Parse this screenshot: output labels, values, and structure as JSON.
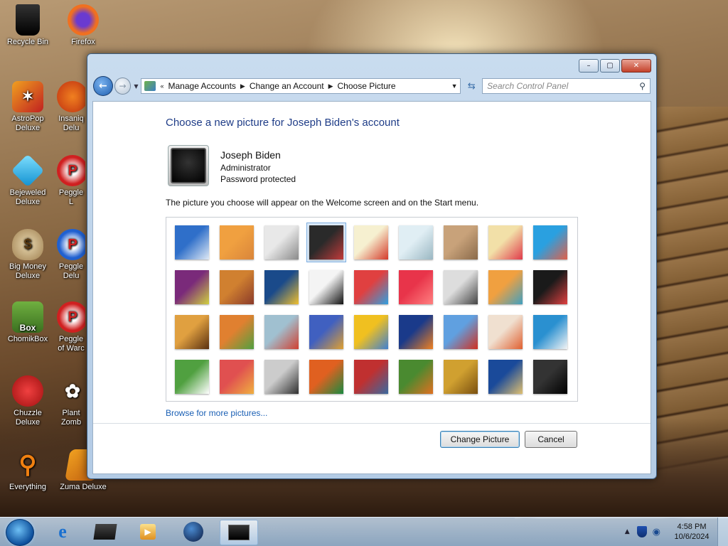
{
  "desktop": {
    "icons": [
      {
        "label": "Recycle Bin",
        "icon": "recycle-bin-icon"
      },
      {
        "label": "Firefox",
        "icon": "firefox-icon"
      },
      {
        "label": "AstroPop Deluxe",
        "icon": "astropop-icon"
      },
      {
        "label": "Insaniq Delu",
        "icon": "insaniquarium-icon"
      },
      {
        "label": "Bejeweled Deluxe",
        "icon": "bejeweled-icon"
      },
      {
        "label": "Peggle L",
        "icon": "peggle-icon"
      },
      {
        "label": "Big Money Deluxe",
        "icon": "money-bag-icon"
      },
      {
        "label": "Peggle Delu",
        "icon": "peggle-icon"
      },
      {
        "label": "ChomikBox",
        "icon": "chomikbox-icon"
      },
      {
        "label": "Peggle of Warc",
        "icon": "peggle-icon"
      },
      {
        "label": "Chuzzle Deluxe",
        "icon": "chuzzle-icon"
      },
      {
        "label": "Plant Zomb",
        "icon": "plants-zombies-icon"
      },
      {
        "label": "Everything",
        "icon": "magnifier-icon"
      },
      {
        "label": "Zuma Deluxe",
        "icon": "zuma-icon"
      }
    ]
  },
  "window": {
    "controls": {
      "minimize": "–",
      "maximize": "▢",
      "close": "✕"
    },
    "nav": {
      "back": "←",
      "forward": "→",
      "breadcrumbs": [
        "Manage Accounts",
        "Change an Account",
        "Choose Picture"
      ],
      "search_placeholder": "Search Control Panel"
    },
    "title": "Choose a new picture for Joseph Biden's account",
    "user": {
      "name": "Joseph Biden",
      "role": "Administrator",
      "status": "Password protected"
    },
    "description": "The picture you choose will appear on the Welcome screen and on the Start menu.",
    "pictures": [
      {
        "name": "roller-coaster",
        "c1": "#2f6fc9",
        "c2": "#dfe9f5"
      },
      {
        "name": "starfish",
        "c1": "#f0a040",
        "c2": "#d9853a"
      },
      {
        "name": "robot-toy",
        "c1": "#e8e8e8",
        "c2": "#8a8a8a"
      },
      {
        "name": "record-player",
        "c1": "#2a2a2a",
        "c2": "#c23a3a"
      },
      {
        "name": "lucky-cat",
        "c1": "#f6f0d0",
        "c2": "#d43a2a"
      },
      {
        "name": "gyroscope",
        "c1": "#e0eef4",
        "c2": "#9ab7c2"
      },
      {
        "name": "kitten",
        "c1": "#c8a27a",
        "c2": "#8a6a4a"
      },
      {
        "name": "flower",
        "c1": "#f2e0a8",
        "c2": "#e03a4a"
      },
      {
        "name": "pinwheel",
        "c1": "#2aa0e0",
        "c2": "#e0604a"
      },
      {
        "name": "ball",
        "c1": "#7a2a7a",
        "c2": "#d0d040"
      },
      {
        "name": "fabric",
        "c1": "#d08030",
        "c2": "#8a3a2a"
      },
      {
        "name": "leaf",
        "c1": "#1a4a8a",
        "c2": "#f0c030"
      },
      {
        "name": "dog",
        "c1": "#f4f4f4",
        "c2": "#111111"
      },
      {
        "name": "crayons",
        "c1": "#e04040",
        "c2": "#30a0e0"
      },
      {
        "name": "red-leaf",
        "c1": "#e8344a",
        "c2": "#ff8080"
      },
      {
        "name": "jacks",
        "c1": "#dddddd",
        "c2": "#444444"
      },
      {
        "name": "stairs",
        "c1": "#f0a040",
        "c2": "#40a0c0"
      },
      {
        "name": "paper-crane",
        "c1": "#1a1a1a",
        "c2": "#e04040"
      },
      {
        "name": "guitar",
        "c1": "#e0a040",
        "c2": "#5a3010"
      },
      {
        "name": "pomeranian",
        "c1": "#e08030",
        "c2": "#50a040"
      },
      {
        "name": "tin-robot",
        "c1": "#a0c0d0",
        "c2": "#d04030"
      },
      {
        "name": "scarf",
        "c1": "#4060c0",
        "c2": "#e0a030"
      },
      {
        "name": "sunflower",
        "c1": "#f0c020",
        "c2": "#4080d0"
      },
      {
        "name": "fish",
        "c1": "#1a3a8a",
        "c2": "#f08020"
      },
      {
        "name": "hot-air-balloon",
        "c1": "#60a0e0",
        "c2": "#d03020"
      },
      {
        "name": "origami",
        "c1": "#f0e0d0",
        "c2": "#e06030"
      },
      {
        "name": "sailboat",
        "c1": "#2a90d0",
        "c2": "#f4f4f4"
      },
      {
        "name": "soccer-ball",
        "c1": "#50a040",
        "c2": "#ffffff"
      },
      {
        "name": "striped-fabric",
        "c1": "#e05050",
        "c2": "#f0b040"
      },
      {
        "name": "marbles",
        "c1": "#cccccc",
        "c2": "#303030"
      },
      {
        "name": "window-frame",
        "c1": "#e06020",
        "c2": "#1a8a40"
      },
      {
        "name": "textile",
        "c1": "#c03030",
        "c2": "#3a6aa0"
      },
      {
        "name": "butterfly",
        "c1": "#4a8a30",
        "c2": "#e07020"
      },
      {
        "name": "shell",
        "c1": "#d0a030",
        "c2": "#7a5010"
      },
      {
        "name": "lighthouse",
        "c1": "#1a4a9a",
        "c2": "#e0c070"
      },
      {
        "name": "current-account",
        "c1": "#333333",
        "c2": "#000000"
      }
    ],
    "selected_picture_index": 3,
    "browse_link": "Browse for more pictures...",
    "buttons": {
      "change": "Change Picture",
      "cancel": "Cancel"
    }
  },
  "taskbar": {
    "time": "4:58 PM",
    "date": "10/6/2024"
  }
}
